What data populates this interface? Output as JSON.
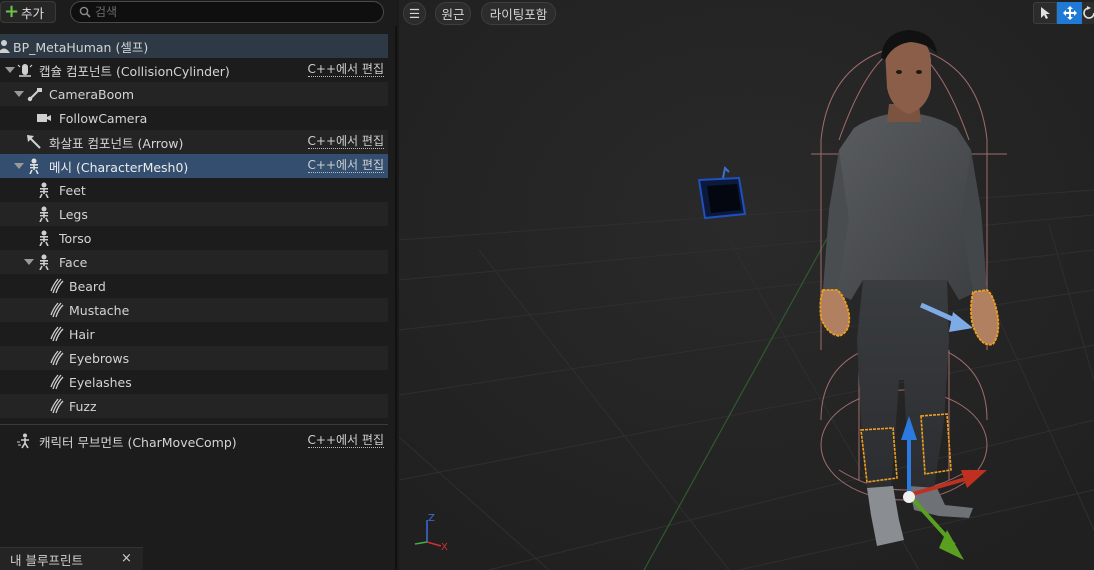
{
  "toolbar": {
    "add_label": "추가",
    "search_placeholder": "검색"
  },
  "tree": {
    "root": "BP_MetaHuman (셀프)",
    "capsule": "캡슐 컴포넌트 (CollisionCylinder)",
    "camera_boom": "CameraBoom",
    "follow_camera": "FollowCamera",
    "arrow": "화살표 컴포넌트 (Arrow)",
    "mesh": "메시 (CharacterMesh0)",
    "feet": "Feet",
    "legs": "Legs",
    "torso": "Torso",
    "face": "Face",
    "beard": "Beard",
    "mustache": "Mustache",
    "hair": "Hair",
    "eyebrows": "Eyebrows",
    "eyelashes": "Eyelashes",
    "fuzz": "Fuzz",
    "char_move": "캐릭터 무브먼트 (CharMoveComp)",
    "edit_cpp": "C++에서 편집"
  },
  "bottom_tab": {
    "label": "내 블루프린트",
    "close": "×"
  },
  "viewport": {
    "menu_glyph": "☰",
    "perspective": "원근",
    "lighting": "라이팅포함",
    "gizmo_axes": {
      "x": "X",
      "z": "Z"
    }
  },
  "colors": {
    "accent_blue": "#1f7ad6",
    "selection_row": "#334e6e",
    "add_green": "#6cc24a",
    "outline_orange": "#f0a020",
    "capsule_line": "#b87878"
  }
}
